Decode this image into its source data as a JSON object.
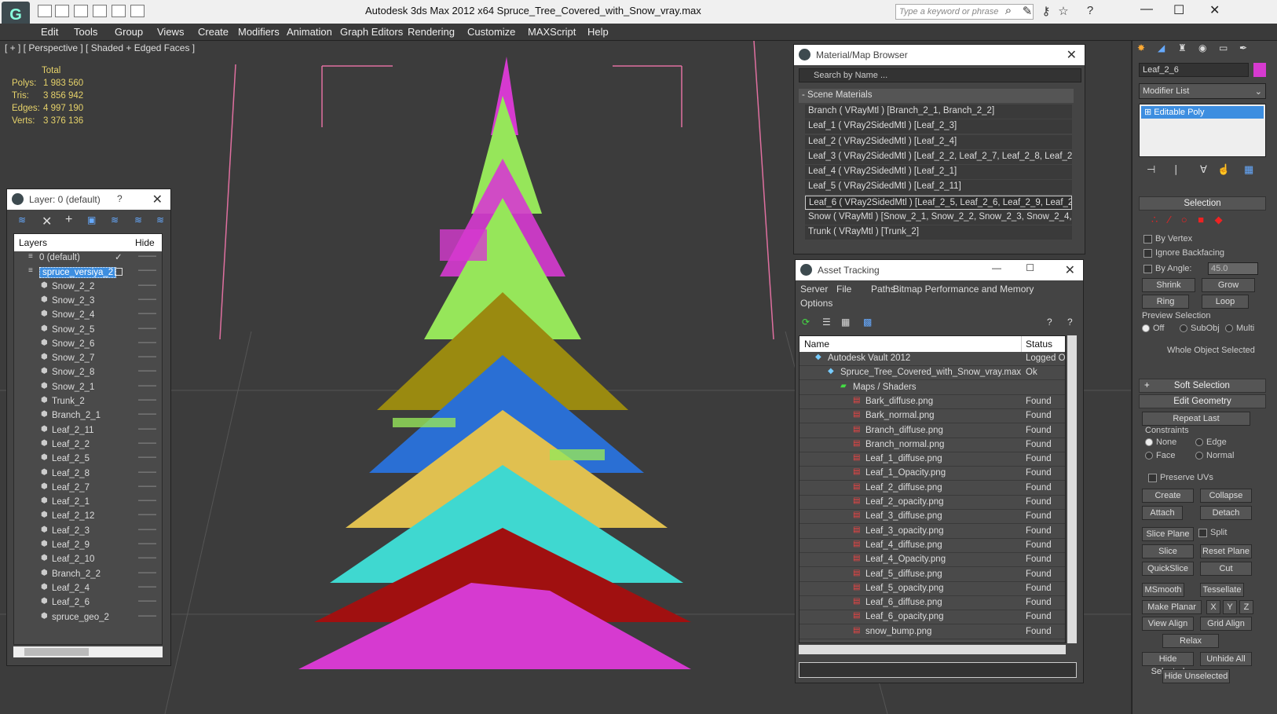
{
  "titlebar": {
    "title": "Autodesk 3ds Max  2012 x64      Spruce_Tree_Covered_with_Snow_vray.max",
    "search_placeholder": "Type a keyword or phrase"
  },
  "menu": [
    "Edit",
    "Tools",
    "Group",
    "Views",
    "Create",
    "Modifiers",
    "Animation",
    "Graph Editors",
    "Rendering",
    "Customize",
    "MAXScript",
    "Help"
  ],
  "viewport": {
    "label": "[ + ] [ Perspective ] [ Shaded + Edged Faces ]",
    "stats_header": "Total",
    "stats": [
      {
        "k": "Polys:",
        "v": "1 983 560"
      },
      {
        "k": "Tris:",
        "v": "3 856 942"
      },
      {
        "k": "Edges:",
        "v": "4 997 190"
      },
      {
        "k": "Verts:",
        "v": "3 376 136"
      }
    ]
  },
  "layer_panel": {
    "title": "Layer: 0 (default)",
    "help": "?",
    "col_layers": "Layers",
    "col_hide": "Hide",
    "items": [
      {
        "name": "0 (default)",
        "level": 0,
        "checked": true
      },
      {
        "name": "spruce_versiya_2",
        "level": 0,
        "selected": true
      },
      {
        "name": "Snow_2_2",
        "level": 1
      },
      {
        "name": "Snow_2_3",
        "level": 1
      },
      {
        "name": "Snow_2_4",
        "level": 1
      },
      {
        "name": "Snow_2_5",
        "level": 1
      },
      {
        "name": "Snow_2_6",
        "level": 1
      },
      {
        "name": "Snow_2_7",
        "level": 1
      },
      {
        "name": "Snow_2_8",
        "level": 1
      },
      {
        "name": "Snow_2_1",
        "level": 1
      },
      {
        "name": "Trunk_2",
        "level": 1
      },
      {
        "name": "Branch_2_1",
        "level": 1
      },
      {
        "name": "Leaf_2_11",
        "level": 1
      },
      {
        "name": "Leaf_2_2",
        "level": 1
      },
      {
        "name": "Leaf_2_5",
        "level": 1
      },
      {
        "name": "Leaf_2_8",
        "level": 1
      },
      {
        "name": "Leaf_2_7",
        "level": 1
      },
      {
        "name": "Leaf_2_1",
        "level": 1
      },
      {
        "name": "Leaf_2_12",
        "level": 1
      },
      {
        "name": "Leaf_2_3",
        "level": 1
      },
      {
        "name": "Leaf_2_9",
        "level": 1
      },
      {
        "name": "Leaf_2_10",
        "level": 1
      },
      {
        "name": "Branch_2_2",
        "level": 1
      },
      {
        "name": "Leaf_2_4",
        "level": 1
      },
      {
        "name": "Leaf_2_6",
        "level": 1
      },
      {
        "name": "spruce_geo_2",
        "level": 1
      }
    ]
  },
  "material_browser": {
    "title": "Material/Map Browser",
    "search": "Search by Name ...",
    "group": "- Scene Materials",
    "items": [
      "Branch  ( VRayMtl )  [Branch_2_1, Branch_2_2]",
      "Leaf_1  ( VRay2SidedMtl )  [Leaf_2_3]",
      "Leaf_2  ( VRay2SidedMtl )  [Leaf_2_4]",
      "Leaf_3  ( VRay2SidedMtl )  [Leaf_2_2, Leaf_2_7, Leaf_2_8, Leaf_2...",
      "Leaf_4  ( VRay2SidedMtl )  [Leaf_2_1]",
      "Leaf_5  ( VRay2SidedMtl )  [Leaf_2_11]",
      "Leaf_6  ( VRay2SidedMtl )  [Leaf_2_5, Leaf_2_6, Leaf_2_9, Leaf_2...",
      "Snow  ( VRayMtl )  [Snow_2_1, Snow_2_2, Snow_2_3, Snow_2_4,...",
      "Trunk  ( VRayMtl )  [Trunk_2]"
    ]
  },
  "asset_tracking": {
    "title": "Asset Tracking",
    "menu": [
      "Server",
      "File",
      "Paths",
      "Bitmap Performance and Memory",
      "Options"
    ],
    "col_name": "Name",
    "col_status": "Status",
    "rows": [
      {
        "name": "Autodesk Vault 2012",
        "status": "Logged O",
        "indent": 0
      },
      {
        "name": "Spruce_Tree_Covered_with_Snow_vray.max",
        "status": "Ok",
        "indent": 1
      },
      {
        "name": "Maps / Shaders",
        "status": "",
        "indent": 2
      },
      {
        "name": "Bark_diffuse.png",
        "status": "Found",
        "indent": 3
      },
      {
        "name": "Bark_normal.png",
        "status": "Found",
        "indent": 3
      },
      {
        "name": "Branch_diffuse.png",
        "status": "Found",
        "indent": 3
      },
      {
        "name": "Branch_normal.png",
        "status": "Found",
        "indent": 3
      },
      {
        "name": "Leaf_1_diffuse.png",
        "status": "Found",
        "indent": 3
      },
      {
        "name": "Leaf_1_Opacity.png",
        "status": "Found",
        "indent": 3
      },
      {
        "name": "Leaf_2_diffuse.png",
        "status": "Found",
        "indent": 3
      },
      {
        "name": "Leaf_2_opacity.png",
        "status": "Found",
        "indent": 3
      },
      {
        "name": "Leaf_3_diffuse.png",
        "status": "Found",
        "indent": 3
      },
      {
        "name": "Leaf_3_opacity.png",
        "status": "Found",
        "indent": 3
      },
      {
        "name": "Leaf_4_diffuse.png",
        "status": "Found",
        "indent": 3
      },
      {
        "name": "Leaf_4_Opacity.png",
        "status": "Found",
        "indent": 3
      },
      {
        "name": "Leaf_5_diffuse.png",
        "status": "Found",
        "indent": 3
      },
      {
        "name": "Leaf_5_opacity.png",
        "status": "Found",
        "indent": 3
      },
      {
        "name": "Leaf_6_diffuse.png",
        "status": "Found",
        "indent": 3
      },
      {
        "name": "Leaf_6_opacity.png",
        "status": "Found",
        "indent": 3
      },
      {
        "name": "snow_bump.png",
        "status": "Found",
        "indent": 3
      }
    ]
  },
  "command_panel": {
    "object_name": "Leaf_2_6",
    "modifier_list": "Modifier List",
    "stack_item": "Editable Poly",
    "selection": "Selection",
    "by_vertex": "By Vertex",
    "ignore_backfacing": "Ignore Backfacing",
    "by_angle": "By Angle:",
    "angle_value": "45.0",
    "shrink": "Shrink",
    "grow": "Grow",
    "ring": "Ring",
    "loop": "Loop",
    "preview_selection": "Preview Selection",
    "off": "Off",
    "subobj": "SubObj",
    "multi": "Multi",
    "whole_object": "Whole Object Selected",
    "soft_selection": "Soft Selection",
    "edit_geometry": "Edit Geometry",
    "repeat_last": "Repeat Last",
    "constraints": "Constraints",
    "none": "None",
    "edge": "Edge",
    "face": "Face",
    "normal": "Normal",
    "preserve_uvs": "Preserve UVs",
    "create": "Create",
    "collapse": "Collapse",
    "attach": "Attach",
    "detach": "Detach",
    "slice_plane": "Slice Plane",
    "split": "Split",
    "slice": "Slice",
    "reset_plane": "Reset Plane",
    "quickslice": "QuickSlice",
    "cut": "Cut",
    "msmooth": "MSmooth",
    "tessellate": "Tessellate",
    "make_planar": "Make Planar",
    "x": "X",
    "y": "Y",
    "z": "Z",
    "view_align": "View Align",
    "grid_align": "Grid Align",
    "relax": "Relax",
    "hide_selected": "Hide Selected",
    "unhide_all": "Unhide All",
    "hide_unselected": "Hide Unselected"
  },
  "colors": {
    "accent": "#3d8ee0",
    "stats": "#e6d26a",
    "magenta": "#d63ad0",
    "green": "#96e65a",
    "blue": "#2a6fd4",
    "red": "#a01010",
    "cyan": "#3fd8d0",
    "gold": "#e0c050",
    "olive": "#9a8a10"
  }
}
